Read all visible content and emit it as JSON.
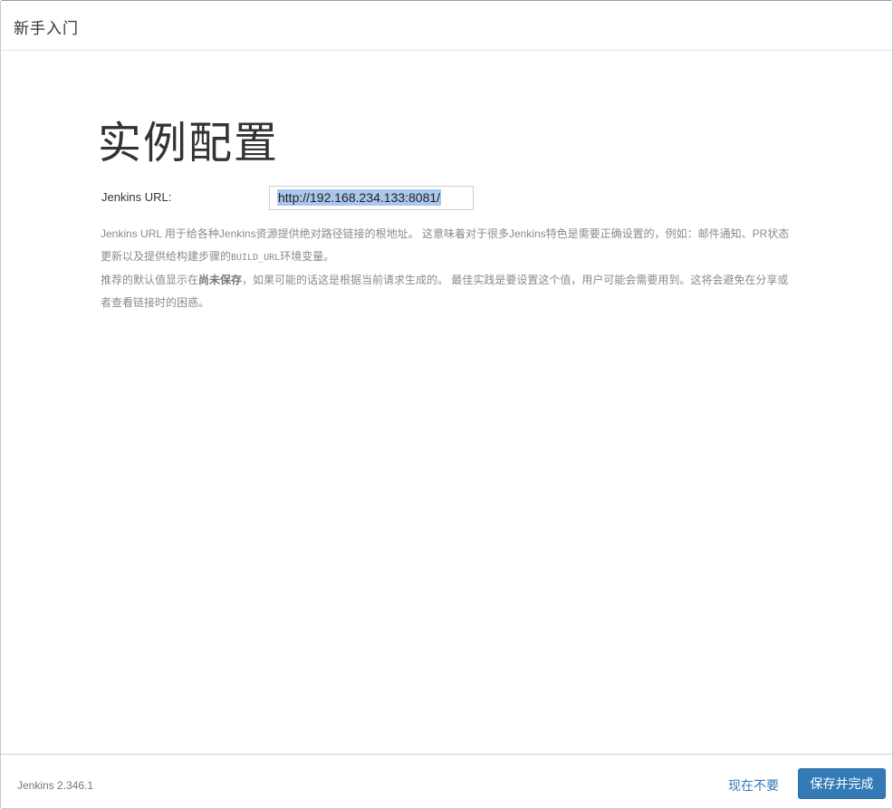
{
  "header": {
    "title": "新手入门"
  },
  "main": {
    "heading": "实例配置",
    "url_label": "Jenkins URL:",
    "url_value": "http://192.168.234.133:8081/",
    "help": {
      "p1_a": "Jenkins URL 用于给各种Jenkins资源提供绝对路径链接的根地址。 这意味着对于很多Jenkins特色是需要正确设置的，例如：邮件通知、PR状态更新以及提供给构建步骤的",
      "p1_code": "BUILD_URL",
      "p1_b": "环境变量。",
      "p2_a": "推荐的默认值显示在",
      "p2_bold": "尚未保存",
      "p2_b": "，如果可能的话这是根据当前请求生成的。 最佳实践是要设置这个值，用户可能会需要用到。这将会避免在分享或者查看链接时的困惑。"
    }
  },
  "footer": {
    "version": "Jenkins 2.346.1",
    "skip_label": "现在不要",
    "save_label": "保存并完成"
  },
  "colors": {
    "primary": "#337ab7",
    "selection": "#a9c7ec"
  }
}
